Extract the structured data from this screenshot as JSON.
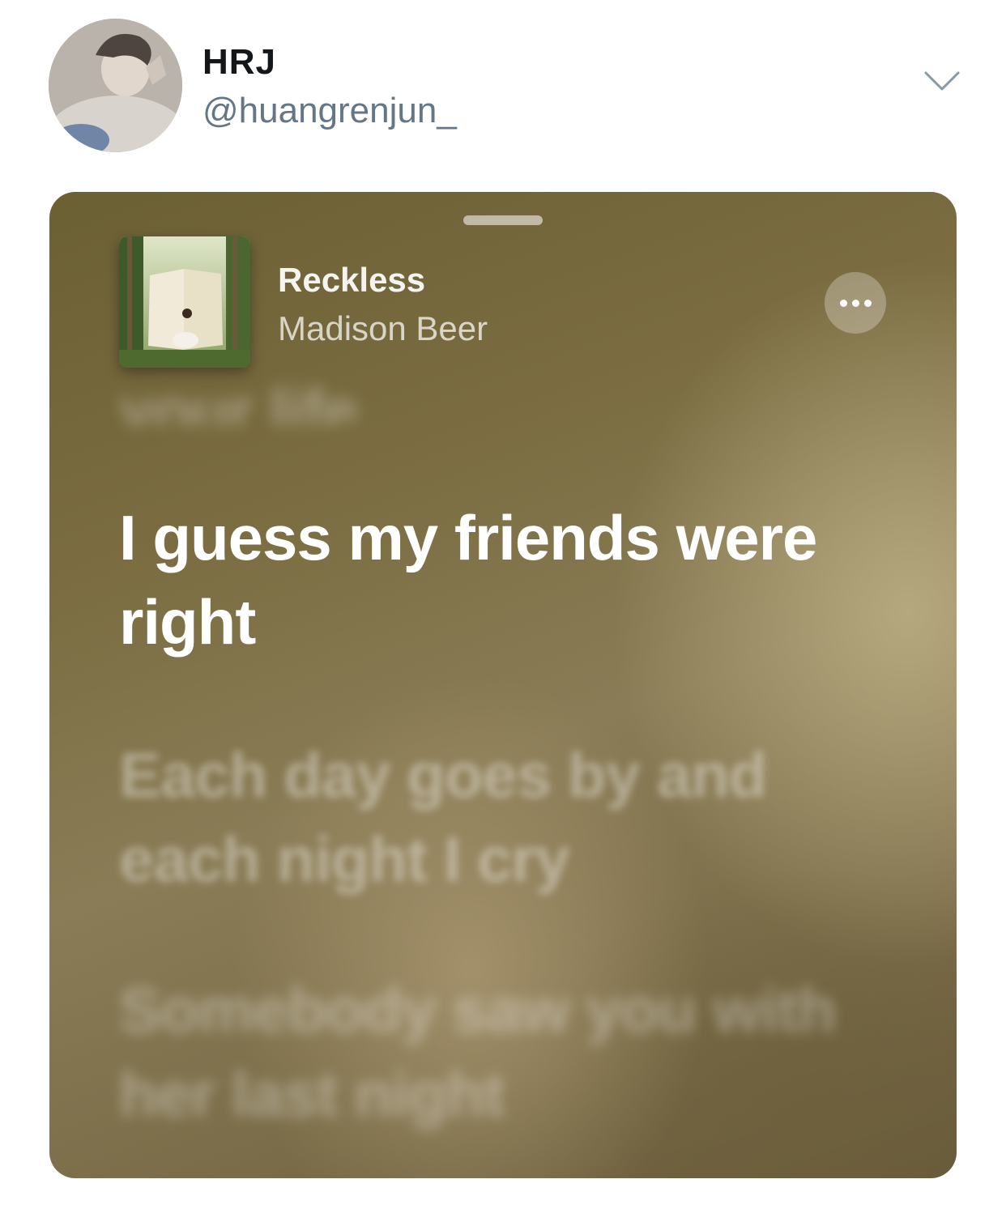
{
  "tweet": {
    "display_name": "HRJ",
    "handle": "@huangrenjun_",
    "avatar_icon": "user-avatar",
    "menu_icon": "chevron-down-icon"
  },
  "card": {
    "song": {
      "title": "Reckless",
      "artist": "Madison Beer",
      "artwork_icon": "album-artwork"
    },
    "more_icon": "ellipsis-icon",
    "lyrics": {
      "previous": "your life",
      "current": "I guess my friends were right",
      "next": "Each day goes by and each night I cry",
      "next2": "Somebody saw you with her last night"
    },
    "colors": {
      "background": "#7b6d41",
      "lyric_active": "#ffffff"
    }
  }
}
